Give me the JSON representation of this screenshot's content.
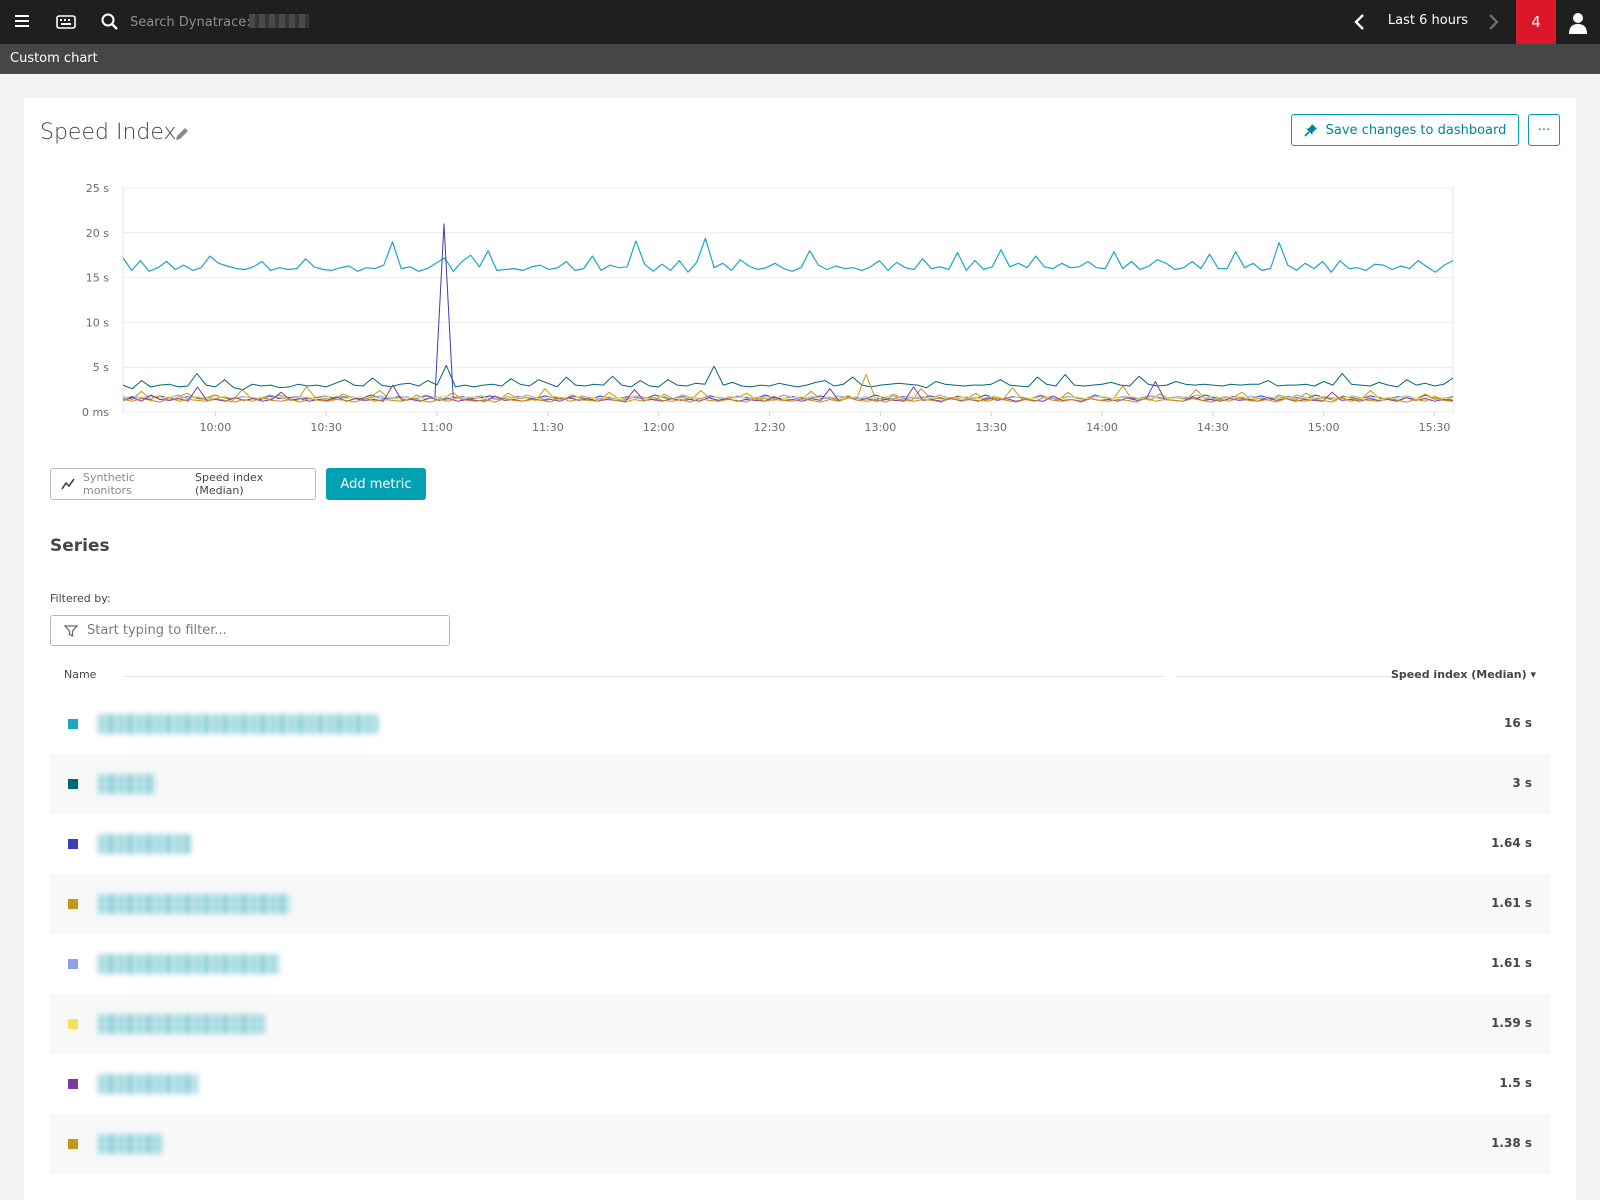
{
  "topbar": {
    "search_placeholder": "Search Dynatrace:",
    "timeframe": "Last 6 hours",
    "problem_count": "4"
  },
  "subbar": {
    "title": "Custom chart"
  },
  "header": {
    "title": "Speed Index",
    "save_label": "Save changes to dashboard",
    "more_label": "···"
  },
  "metric": {
    "category": "Synthetic monitors",
    "name": "Speed index (Median)",
    "add_label": "Add metric"
  },
  "series_section": {
    "title": "Series",
    "filter_label": "Filtered by:",
    "filter_placeholder": "Start typing to filter...",
    "col_name": "Name",
    "col_value": "Speed index (Median) ▾",
    "rows": [
      {
        "value": "16 s",
        "color": "#1aa6c4"
      },
      {
        "value": "3 s",
        "color": "#00667a"
      },
      {
        "value": "1.64 s",
        "color": "#3d3eb5"
      },
      {
        "value": "1.61 s",
        "color": "#c49a0e"
      },
      {
        "value": "1.61 s",
        "color": "#8da2ef"
      },
      {
        "value": "1.59 s",
        "color": "#f5e05c"
      },
      {
        "value": "1.5 s",
        "color": "#7c3a9e"
      },
      {
        "value": "1.38 s",
        "color": "#c49a0e"
      }
    ]
  },
  "chart_data": {
    "type": "line",
    "yticks": [
      "0 ms",
      "5 s",
      "10 s",
      "15 s",
      "20 s",
      "25 s"
    ],
    "ylim": [
      0,
      25
    ],
    "xticks": [
      "10:00",
      "10:30",
      "11:00",
      "11:30",
      "12:00",
      "12:30",
      "13:00",
      "13:30",
      "14:00",
      "14:30",
      "15:00",
      "15:30"
    ],
    "x_range": [
      "09:35",
      "15:35"
    ],
    "grid": true,
    "series": [
      {
        "color": "#1aa6c4",
        "values": [
          17.2,
          15.8,
          16.9,
          15.7,
          16.1,
          16.8,
          15.9,
          16.4,
          15.8,
          16.1,
          17.4,
          16.6,
          16.3,
          16.0,
          15.9,
          16.2,
          16.8,
          15.8,
          16.1,
          15.9,
          16.0,
          17.1,
          16.2,
          15.9,
          15.8,
          16.1,
          16.3,
          15.7,
          16.1,
          16.0,
          16.4,
          19.0,
          16.0,
          16.2,
          15.7,
          16.0,
          16.6,
          17.2,
          15.7,
          16.8,
          17.5,
          16.2,
          18.0,
          15.8,
          15.9,
          16.0,
          15.8,
          16.2,
          16.4,
          15.9,
          16.1,
          16.8,
          15.8,
          16.0,
          17.4,
          15.8,
          16.4,
          16.1,
          16.2,
          19.1,
          16.5,
          15.7,
          16.5,
          15.8,
          16.9,
          15.6,
          16.7,
          19.4,
          16.1,
          16.6,
          15.8,
          17.0,
          16.3,
          15.9,
          16.1,
          16.6,
          16.0,
          15.7,
          16.1,
          18.0,
          16.4,
          15.9,
          16.3,
          16.0,
          16.1,
          15.8,
          16.2,
          16.9,
          15.8,
          16.7,
          16.1,
          15.9,
          17.1,
          16.0,
          16.2,
          15.9,
          17.8,
          15.8,
          16.9,
          15.9,
          16.2,
          18.1,
          16.2,
          16.6,
          16.1,
          17.4,
          16.2,
          16.0,
          16.6,
          16.1,
          16.2,
          16.8,
          16.1,
          16.0,
          17.9,
          16.0,
          16.8,
          15.9,
          16.3,
          17.0,
          16.6,
          15.9,
          16.1,
          16.8,
          16.0,
          17.6,
          16.0,
          16.0,
          17.9,
          16.1,
          16.6,
          15.8,
          16.0,
          18.9,
          16.4,
          15.8,
          16.6,
          16.0,
          16.8,
          15.6,
          16.9,
          16.0,
          16.1,
          15.8,
          16.5,
          16.4,
          15.9,
          16.3,
          16.0,
          16.9,
          16.2,
          15.6,
          16.4,
          16.9
        ]
      },
      {
        "color": "#00667a",
        "values": [
          3.0,
          2.6,
          3.5,
          2.8,
          3.0,
          3.1,
          2.8,
          2.9,
          4.3,
          3.0,
          2.8,
          3.6,
          2.7,
          2.5,
          3.1,
          2.9,
          3.0,
          2.7,
          2.8,
          3.1,
          2.9,
          3.0,
          2.8,
          3.2,
          3.6,
          3.0,
          2.9,
          3.8,
          3.0,
          2.8,
          3.1,
          3.2,
          2.9,
          3.5,
          3.0,
          5.2,
          2.8,
          3.0,
          2.8,
          3.0,
          3.1,
          2.9,
          3.7,
          3.1,
          2.9,
          3.6,
          3.2,
          2.8,
          3.9,
          3.0,
          2.9,
          3.1,
          3.0,
          4.0,
          3.0,
          2.8,
          3.5,
          2.9,
          2.8,
          3.6,
          3.0,
          2.9,
          3.2,
          3.1,
          5.1,
          3.0,
          3.3,
          2.9,
          2.8,
          3.0,
          2.9,
          3.2,
          3.0,
          2.8,
          3.0,
          3.3,
          3.5,
          2.9,
          3.1,
          3.9,
          3.0,
          2.8,
          3.0,
          3.1,
          3.2,
          3.1,
          3.0,
          2.7,
          3.4,
          3.1,
          3.0,
          2.9,
          3.0,
          3.0,
          3.1,
          3.6,
          3.0,
          2.9,
          2.8,
          3.9,
          3.1,
          2.9,
          4.2,
          3.0,
          2.9,
          3.0,
          3.1,
          3.3,
          3.0,
          2.9,
          4.0,
          3.1,
          2.9,
          3.0,
          3.4,
          3.1,
          3.0,
          3.1,
          3.0,
          2.9,
          3.1,
          3.0,
          3.1,
          3.1,
          3.5,
          2.9,
          3.0,
          3.0,
          3.1,
          2.9,
          3.4,
          3.0,
          4.3,
          3.1,
          3.0,
          2.9,
          3.3,
          3.0,
          2.8,
          3.6,
          3.0,
          3.2,
          2.9,
          3.1,
          3.8
        ]
      },
      {
        "color": "#3d3eb5",
        "values": [
          1.5,
          1.7,
          1.6,
          1.4,
          1.8,
          1.6,
          1.5,
          1.7,
          1.6,
          1.5,
          1.9,
          1.6,
          1.5,
          1.7,
          1.6,
          1.4,
          1.8,
          1.5,
          1.6,
          1.7,
          1.5,
          1.6,
          1.8,
          1.5,
          1.7,
          1.6,
          1.5,
          1.9,
          1.6,
          1.5,
          1.7,
          1.6,
          1.5,
          1.8,
          1.6,
          21.0,
          1.6,
          1.7,
          1.5,
          1.6,
          1.8,
          1.6,
          1.5,
          1.7,
          1.6,
          1.5,
          1.8,
          1.6,
          1.5,
          1.7,
          1.6,
          1.4,
          1.8,
          1.6,
          1.5,
          1.7,
          1.6,
          1.5,
          1.9,
          1.6,
          1.5,
          1.7,
          1.6,
          1.5,
          1.8,
          1.6,
          1.5,
          1.7,
          1.6,
          1.5,
          1.9,
          1.6,
          1.5,
          1.7,
          1.6,
          1.5,
          1.8,
          1.6,
          1.5,
          1.7,
          1.6,
          1.5,
          1.9,
          1.6,
          1.5,
          1.7,
          1.6,
          1.5,
          1.8,
          1.6,
          1.5,
          1.7,
          1.6,
          1.5,
          1.9,
          1.6,
          1.5,
          1.7,
          1.6,
          1.5,
          1.8,
          1.6,
          1.5,
          1.7,
          1.6,
          1.5,
          1.9,
          1.6,
          1.5,
          1.7,
          1.6,
          1.5,
          1.8,
          1.6,
          1.5,
          1.7,
          1.6,
          1.5,
          1.9,
          1.6,
          1.5,
          1.7,
          1.6,
          1.5,
          1.8,
          1.6,
          1.5,
          1.7,
          1.6,
          1.5,
          1.9,
          1.6,
          1.5,
          1.7,
          1.6,
          1.5,
          1.8,
          1.6,
          1.5,
          1.7,
          1.6,
          1.5,
          1.9,
          1.6,
          1.5,
          1.7
        ]
      },
      {
        "color": "#c49a0e",
        "values": [
          1.6,
          1.4,
          2.3,
          1.5,
          1.8,
          1.3,
          1.7,
          2.1,
          1.5,
          1.4,
          1.9,
          1.6,
          1.3,
          2.5,
          1.5,
          1.6,
          1.4,
          1.9,
          1.5,
          1.3,
          2.8,
          1.6,
          1.5,
          1.4,
          2.0,
          1.6,
          1.3,
          1.7,
          2.4,
          1.5,
          1.6,
          1.3,
          1.9,
          1.4,
          1.7,
          1.5,
          2.2,
          1.3,
          1.6,
          1.8,
          1.5,
          1.4,
          2.1,
          1.5,
          1.6,
          1.3,
          2.6,
          1.5,
          1.4,
          1.9,
          1.5,
          1.6,
          1.3,
          2.2,
          1.5,
          1.4,
          1.8,
          1.6,
          1.3,
          2.0,
          1.5,
          1.6,
          1.4,
          2.4,
          1.5,
          1.3,
          1.7,
          1.6,
          2.1,
          1.4,
          1.5,
          1.3,
          1.9,
          1.6,
          1.4,
          2.3,
          1.5,
          1.6,
          1.3,
          1.8,
          1.5,
          4.2,
          1.6,
          1.4,
          2.0,
          1.5,
          1.3,
          2.6,
          1.6,
          1.5,
          1.4,
          1.8,
          1.5,
          2.1,
          1.3,
          1.6,
          1.5,
          2.7,
          1.4,
          1.5,
          1.9,
          1.6,
          1.3,
          2.2,
          1.5,
          1.4,
          1.8,
          1.6,
          1.5,
          2.9,
          1.4,
          1.6,
          1.3,
          2.0,
          1.5,
          1.6,
          1.4,
          2.5,
          1.5,
          1.3,
          1.7,
          1.6,
          2.2,
          1.4,
          1.5,
          1.3,
          1.9,
          1.6,
          1.4,
          2.1,
          1.5,
          1.6,
          1.3,
          1.8,
          1.5,
          1.4,
          2.4,
          1.5,
          1.6,
          1.3,
          1.7,
          1.5,
          2.0,
          1.4,
          1.6,
          1.3
        ]
      },
      {
        "color": "#8da2ef",
        "values": [
          1.7,
          1.5,
          1.6,
          1.8,
          1.4,
          1.6,
          1.9,
          1.5,
          1.7,
          1.6,
          1.4,
          1.8,
          1.5,
          1.7,
          1.6,
          1.5,
          1.9,
          1.6,
          1.4,
          1.7,
          1.6,
          1.5,
          1.8,
          1.6,
          1.5,
          1.7,
          1.4,
          1.6,
          1.8,
          1.5,
          1.6,
          1.7,
          1.5,
          1.9,
          1.6,
          1.5,
          1.7,
          1.6,
          1.4,
          1.8,
          1.5,
          1.6,
          1.7,
          1.5,
          1.9,
          1.6,
          1.4,
          1.7,
          1.6,
          1.5,
          1.8,
          1.6,
          1.5,
          1.7,
          1.4,
          1.6,
          1.8,
          1.5,
          1.6,
          1.7,
          1.5,
          1.9,
          1.6,
          1.5,
          1.7,
          1.6,
          1.4,
          1.8,
          1.5,
          1.6,
          1.7,
          1.5,
          1.9,
          1.6,
          1.4,
          1.7,
          1.6,
          1.5,
          1.8,
          1.6,
          1.5,
          1.7,
          1.4,
          1.6,
          1.8,
          1.5,
          1.6,
          1.7,
          1.5,
          1.9,
          1.6,
          1.5,
          1.7,
          1.6,
          1.4,
          1.8,
          1.5,
          1.6,
          1.7,
          1.5,
          1.9,
          1.6,
          1.4,
          1.7,
          1.6,
          1.5,
          1.8,
          1.6,
          1.5,
          1.7,
          1.4,
          1.6,
          1.8,
          1.5,
          1.6,
          1.7,
          1.5,
          1.9,
          1.6,
          1.5,
          1.7,
          1.6,
          1.4,
          1.8,
          1.5,
          1.6,
          1.7,
          1.5,
          1.9,
          1.6,
          1.4,
          1.7,
          1.6,
          1.5,
          1.8,
          1.6,
          1.5,
          1.7,
          1.4,
          1.6,
          1.8,
          1.5,
          1.6,
          1.7,
          1.5,
          1.6
        ]
      },
      {
        "color": "#f5e05c",
        "values": [
          1.6,
          1.5,
          1.7,
          1.5,
          1.6,
          1.7,
          1.5,
          1.6,
          1.7,
          1.5,
          1.6,
          1.8,
          1.5,
          1.6,
          1.7,
          1.5,
          1.6,
          1.7,
          1.5,
          1.6,
          1.7,
          1.5,
          1.6,
          1.8,
          1.5,
          1.6,
          1.7,
          1.5,
          1.6,
          1.7,
          1.5,
          1.6,
          1.7,
          1.5,
          1.6,
          1.8,
          1.5,
          1.6,
          1.7,
          1.5,
          1.6,
          1.7,
          1.5,
          1.6,
          1.7,
          1.5,
          1.6,
          1.8,
          1.5,
          1.6,
          1.7,
          1.5,
          1.6,
          1.7,
          1.5,
          1.6,
          1.7,
          1.5,
          1.6,
          1.8,
          1.5,
          1.6,
          1.7,
          1.5,
          1.6,
          1.7,
          1.5,
          1.6,
          1.7,
          1.5,
          1.6,
          1.8,
          1.5,
          1.6,
          1.7,
          1.5,
          1.6,
          1.7,
          1.5,
          1.6,
          1.7,
          1.5,
          1.6,
          1.8,
          1.5,
          1.6,
          1.7,
          1.5,
          1.6,
          1.7,
          1.5,
          1.6,
          1.7,
          1.5,
          1.6,
          1.8,
          1.5,
          1.6,
          1.7,
          1.5,
          1.6,
          1.7,
          1.5,
          1.6,
          1.7,
          1.5,
          1.6,
          1.8,
          1.5,
          1.6,
          1.7,
          1.5,
          1.6,
          1.7,
          1.5,
          1.6,
          1.7,
          1.5,
          1.6,
          1.8,
          1.5,
          1.6,
          1.7,
          1.5,
          1.6,
          1.7,
          1.5,
          1.6,
          1.7,
          1.5,
          1.6,
          1.8,
          1.5,
          1.6,
          1.7,
          1.5,
          1.6,
          1.7,
          1.5,
          1.6,
          1.7,
          1.5,
          1.6,
          1.8,
          1.5,
          1.6
        ]
      },
      {
        "color": "#7c3a9e",
        "values": [
          1.3,
          1.6,
          1.2,
          1.9,
          1.4,
          1.3,
          1.5,
          1.2,
          2.8,
          1.3,
          1.4,
          1.2,
          1.6,
          1.3,
          1.5,
          1.2,
          1.4,
          2.2,
          1.3,
          1.5,
          1.2,
          1.4,
          1.3,
          1.7,
          1.2,
          1.5,
          1.3,
          1.4,
          1.2,
          3.0,
          1.3,
          1.4,
          1.2,
          1.6,
          1.3,
          1.5,
          1.2,
          1.4,
          1.3,
          1.2,
          1.8,
          1.3,
          1.4,
          1.2,
          1.5,
          1.3,
          1.4,
          1.2,
          1.6,
          1.3,
          1.5,
          1.2,
          1.4,
          1.3,
          1.2,
          2.5,
          1.3,
          1.4,
          1.2,
          1.5,
          1.3,
          1.4,
          1.2,
          1.6,
          1.3,
          1.5,
          1.2,
          1.4,
          1.3,
          1.2,
          1.7,
          1.3,
          1.4,
          1.2,
          1.5,
          1.3,
          2.6,
          1.2,
          1.6,
          1.3,
          1.5,
          1.2,
          1.4,
          1.3,
          1.2,
          2.8,
          1.3,
          1.4,
          1.2,
          1.5,
          1.3,
          1.4,
          1.2,
          1.6,
          1.3,
          1.5,
          1.2,
          1.4,
          1.3,
          1.2,
          1.8,
          1.3,
          1.4,
          1.2,
          1.5,
          1.3,
          1.4,
          1.2,
          1.6,
          1.3,
          1.5,
          3.4,
          1.4,
          1.3,
          1.2,
          1.7,
          1.3,
          1.4,
          1.2,
          1.5,
          1.3,
          1.4,
          1.2,
          1.6,
          1.3,
          1.5,
          1.2,
          1.4,
          1.3,
          1.2,
          2.2,
          1.3,
          1.4,
          1.2,
          1.5,
          1.3,
          1.4,
          1.2,
          1.6,
          1.3,
          1.5,
          1.2,
          1.4,
          1.3
        ]
      },
      {
        "color": "#d4881c",
        "values": [
          1.4,
          1.2,
          1.5,
          1.3,
          1.1,
          1.6,
          1.2,
          1.4,
          1.3,
          1.2,
          1.5,
          1.3,
          1.1,
          1.4,
          1.2,
          1.6,
          1.3,
          1.2,
          1.4,
          1.1,
          1.5,
          1.3,
          1.2,
          1.4,
          1.3,
          1.1,
          1.6,
          1.2,
          1.4,
          1.3,
          1.2,
          1.5,
          1.3,
          1.1,
          1.4,
          1.2,
          1.6,
          1.3,
          1.2,
          1.4,
          1.1,
          1.5,
          1.3,
          1.2,
          1.4,
          1.3,
          1.1,
          1.6,
          1.2,
          1.4,
          1.3,
          1.2,
          1.5,
          1.3,
          1.1,
          1.4,
          1.2,
          1.6,
          1.3,
          1.2,
          1.4,
          1.1,
          1.5,
          1.3,
          1.2,
          1.4,
          1.3,
          1.1,
          1.6,
          1.2,
          1.4,
          1.3,
          1.2,
          1.5,
          1.3,
          1.1,
          1.4,
          1.2,
          1.6,
          1.3,
          1.2,
          1.4,
          1.1,
          1.5,
          1.3,
          1.2,
          1.4,
          1.3,
          1.1,
          1.6,
          1.2,
          1.4,
          1.3,
          1.2,
          1.5,
          1.3,
          1.1,
          1.4,
          1.2,
          1.6,
          1.3,
          1.2,
          1.4,
          1.1,
          1.5,
          1.3,
          1.2,
          1.4,
          1.3,
          1.1,
          1.6,
          1.2,
          1.4,
          1.3,
          1.2,
          1.5,
          1.3,
          1.1,
          1.4,
          1.2,
          1.6,
          1.3,
          1.2,
          1.4,
          1.1,
          1.5,
          1.3,
          1.2,
          1.4,
          1.3,
          1.1,
          1.6,
          1.2,
          1.4,
          1.3,
          1.2,
          1.5,
          1.3,
          1.1,
          1.4,
          1.2,
          1.6,
          1.3,
          1.2
        ]
      }
    ]
  }
}
